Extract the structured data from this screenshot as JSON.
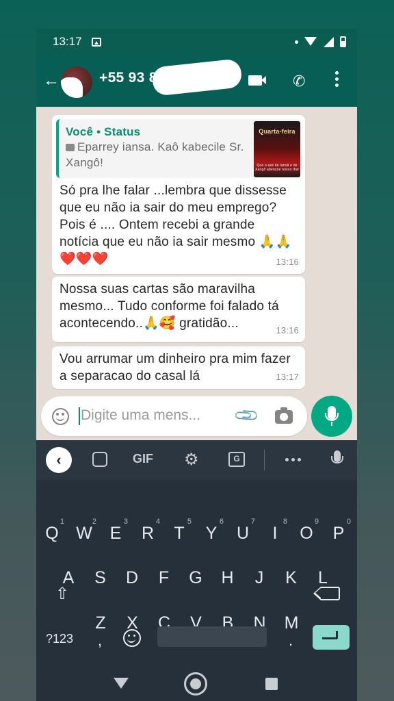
{
  "status_bar": {
    "time": "13:17"
  },
  "header": {
    "contact_name": "+55 93 8"
  },
  "messages": [
    {
      "quote_author": "Você • Status",
      "quote_text": "Eparrey iansa. Kaô kabecile Sr. Xangô!",
      "quote_thumb_title": "Quarta-feira",
      "quote_thumb_caption": "Que o axé de Iansã e de Xangô abençoe nosso dia!",
      "text": "Só pra lhe falar ...lembra que dissesse que eu não ia sair do meu emprego? Pois é .... Ontem recebi a grande notícia que eu não ia sair mesmo 🙏🙏❤️❤️❤️",
      "time": "13:16"
    },
    {
      "text": "Nossa suas cartas são maravilha mesmo... Tudo conforme foi falado tá acontecendo..🙏🥰 gratidão...",
      "time": "13:16"
    },
    {
      "text": "Vou arrumar um dinheiro pra mim fazer a separacao do casal lá",
      "time": "13:17"
    }
  ],
  "composer": {
    "placeholder": "Digite uma mens..."
  },
  "keyboard": {
    "toolbar_gif": "GIF",
    "row1": [
      {
        "k": "Q",
        "n": "1"
      },
      {
        "k": "W",
        "n": "2"
      },
      {
        "k": "E",
        "n": "3"
      },
      {
        "k": "R",
        "n": "4"
      },
      {
        "k": "T",
        "n": "5"
      },
      {
        "k": "Y",
        "n": "6"
      },
      {
        "k": "U",
        "n": "7"
      },
      {
        "k": "I",
        "n": "8"
      },
      {
        "k": "O",
        "n": "9"
      },
      {
        "k": "P",
        "n": "0"
      }
    ],
    "row2": [
      "A",
      "S",
      "D",
      "F",
      "G",
      "H",
      "J",
      "K",
      "L"
    ],
    "row3": [
      "Z",
      "X",
      "C",
      "V",
      "B",
      "N",
      "M"
    ],
    "symbols_label": "?123",
    "comma": ",",
    "period": "."
  },
  "colors": {
    "header_bg": "#075e54",
    "accent": "#00a884",
    "bubble_bg": "#ffffff",
    "chat_bg": "#e5ddd5",
    "keyboard_bg": "#25303a"
  }
}
